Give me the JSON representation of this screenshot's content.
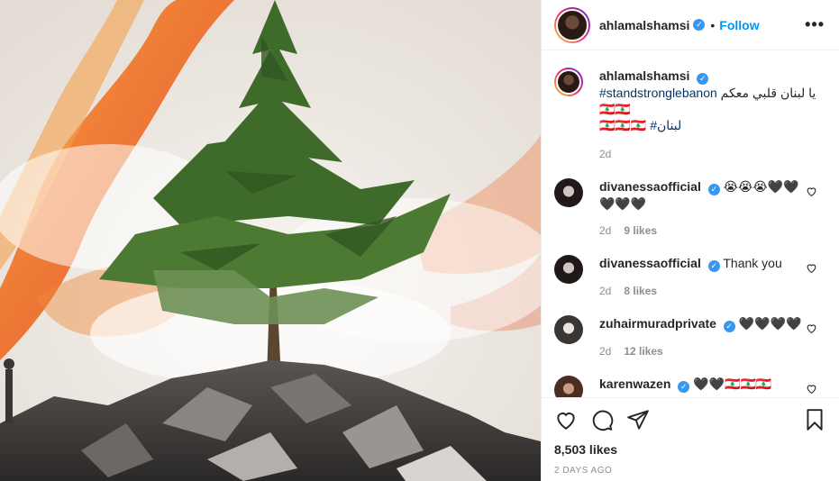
{
  "post_author": {
    "username": "ahlamalshamsi",
    "verified_icon": "verified-badge-icon",
    "follow_label": "Follow",
    "separator": "•",
    "more_icon": "•••"
  },
  "caption": {
    "username": "ahlamalshamsi",
    "hashtag": "#standstronglebanon",
    "text_arabic": "يا لبنان قلبي معكم",
    "flag": "🇱🇧🇱🇧",
    "line2_emoji": "🇱🇧🇱🇧🇱🇧",
    "hashtag2": "#لبنان",
    "time": "2d"
  },
  "comments": [
    {
      "username": "divanessaofficial",
      "verified": true,
      "text": "😭😭😭🖤🖤🖤🖤🖤",
      "time": "2d",
      "likes": "9 likes"
    },
    {
      "username": "divanessaofficial",
      "verified": true,
      "text": "Thank you",
      "time": "2d",
      "likes": "8 likes"
    },
    {
      "username": "zuhairmuradprivate",
      "verified": true,
      "text": "🖤🖤🖤🖤",
      "time": "2d",
      "likes": "12 likes"
    },
    {
      "username": "karenwazen",
      "verified": true,
      "text": "🖤🖤🇱🇧🇱🇧🇱🇧",
      "time": "",
      "likes": ""
    }
  ],
  "action_bar": {
    "icons": [
      "heart-icon",
      "comment-icon",
      "share-icon",
      "bookmark-icon"
    ],
    "likes": "8,503 likes",
    "posted": "2 DAYS AGO"
  },
  "colors": {
    "link": "#0095f6",
    "verified": "#3897f0",
    "muted": "#8e8e8e",
    "fire": "#f05a24"
  }
}
